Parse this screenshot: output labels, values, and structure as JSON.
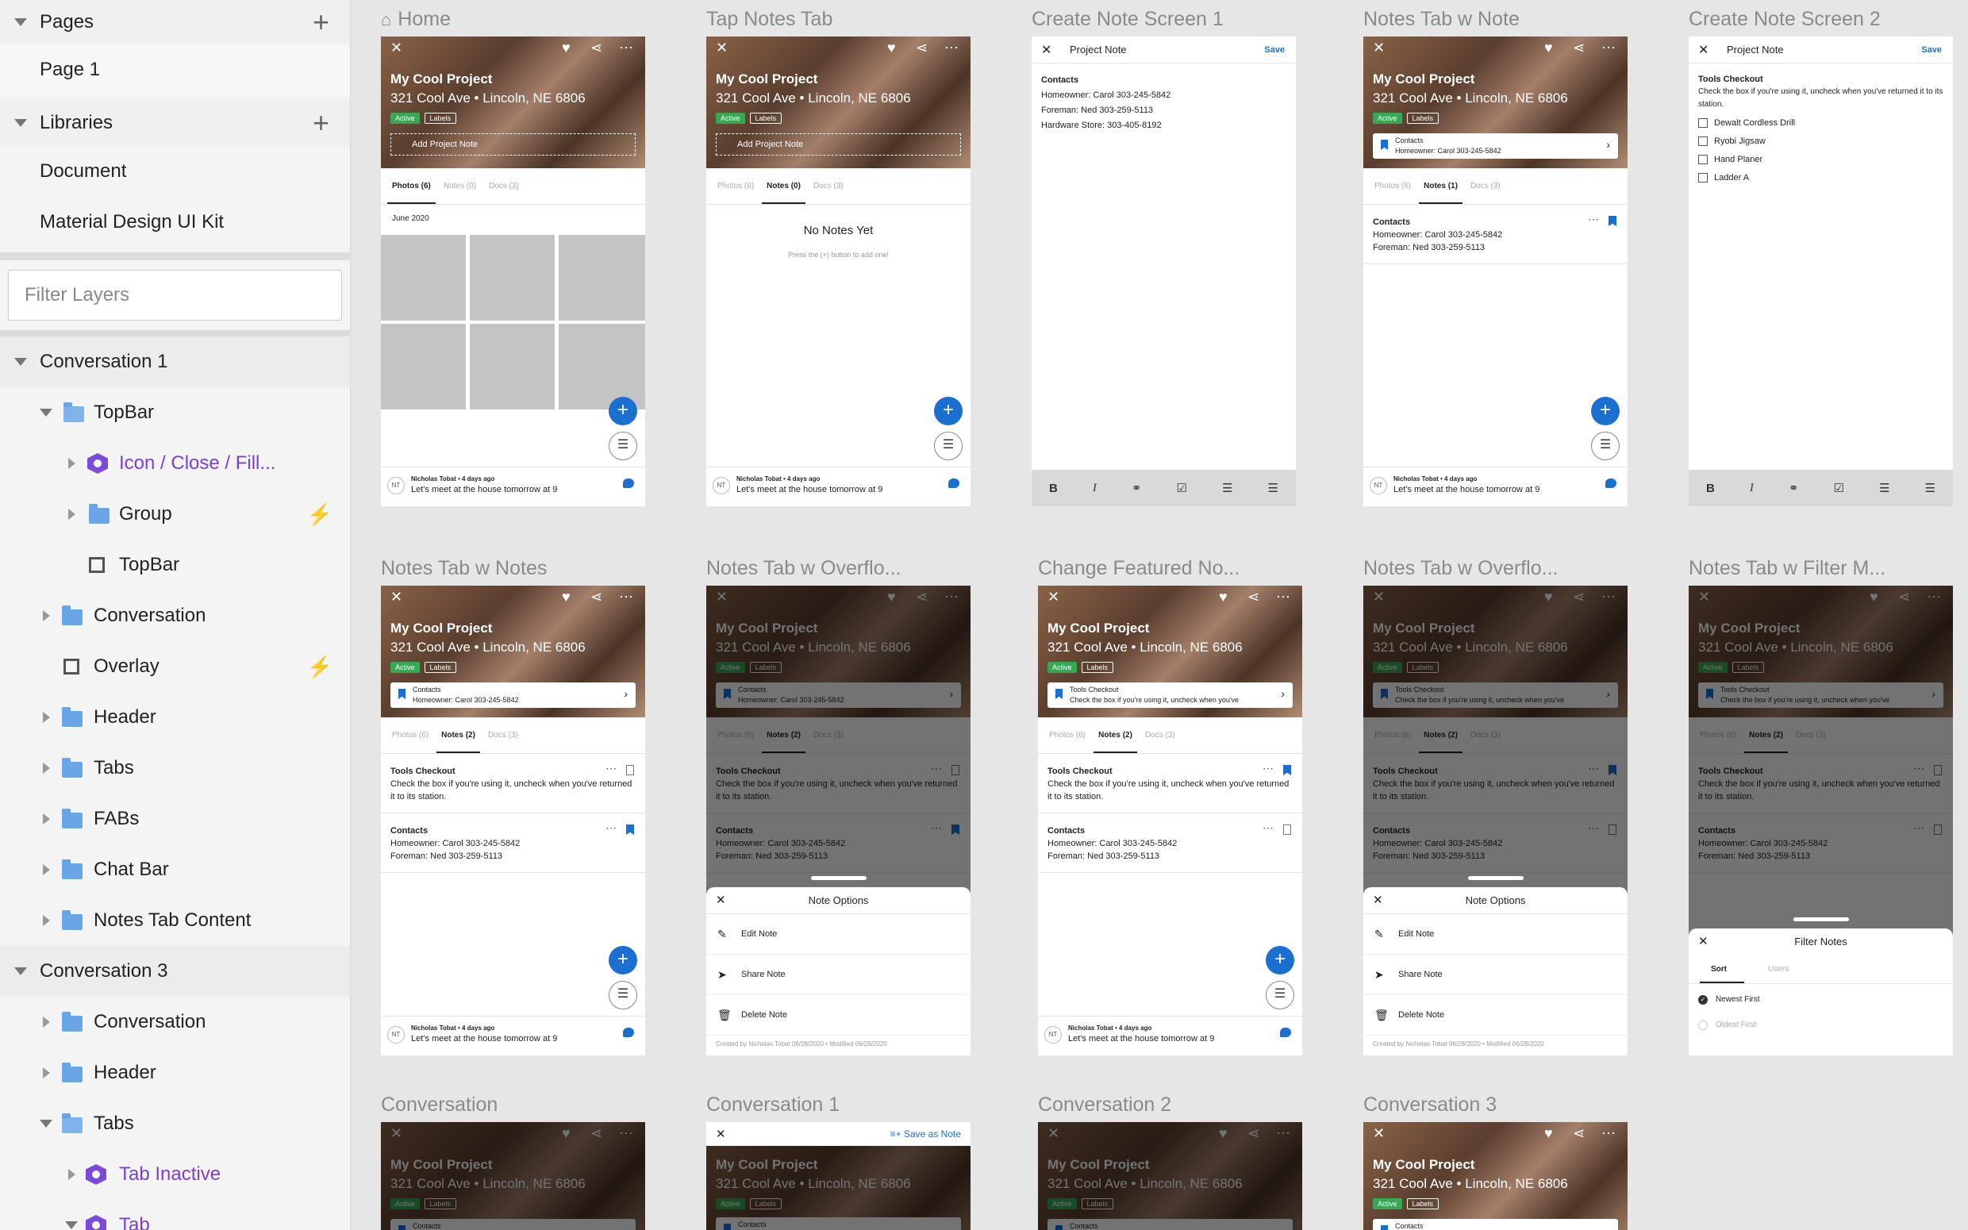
{
  "sidebar": {
    "pages_title": "Pages",
    "page1": "Page 1",
    "libraries_title": "Libraries",
    "lib_document": "Document",
    "lib_material": "Material Design UI Kit",
    "filter_placeholder": "Filter Layers",
    "layers": {
      "conversation1": "Conversation 1",
      "topbar_group": "TopBar",
      "icon_close": "Icon / Close / Fill...",
      "group": "Group",
      "topbar_layer": "TopBar",
      "conversation": "Conversation",
      "overlay": "Overlay",
      "header": "Header",
      "tabs": "Tabs",
      "fabs": "FABs",
      "chat_bar": "Chat Bar",
      "notes_tab_content": "Notes Tab Content",
      "conversation3": "Conversation 3",
      "c3_conversation": "Conversation",
      "c3_header": "Header",
      "c3_tabs": "Tabs",
      "tab_inactive": "Tab Inactive",
      "tab": "Tab"
    }
  },
  "frames": {
    "home": "Home",
    "tap_notes": "Tap Notes Tab",
    "create_note_1": "Create Note Screen 1",
    "notes_w_note": "Notes Tab w Note",
    "create_note_2": "Create Note Screen 2",
    "notes_w_notes": "Notes Tab w Notes",
    "notes_overflow_1": "Notes Tab w Overflo...",
    "change_featured": "Change Featured No...",
    "notes_overflow_2": "Notes Tab w Overflo...",
    "notes_filter": "Notes Tab w Filter M...",
    "conversation": "Conversation",
    "conversation_1": "Conversation 1",
    "conversation_2": "Conversation 2",
    "conversation_3": "Conversation 3"
  },
  "app": {
    "project_title": "My Cool Project",
    "project_address": "321 Cool Ave • Lincoln, NE 6806",
    "chip_active": "Active",
    "chip_labels": "Labels",
    "add_project_note": "Add Project Note",
    "tab_photos_6": "Photos (6)",
    "tab_notes_0": "Notes (0)",
    "tab_docs_3": "Docs (3)",
    "tab_notes_1": "Notes (1)",
    "tab_notes_2": "Notes (2)",
    "date_june": "June 2020",
    "no_notes_title": "No Notes Yet",
    "no_notes_sub": "Press the (+) button to add one!",
    "chat_name": "Nicholas Tobat • 4 days ago",
    "chat_msg": "Let's meet at the house tomorrow at 9",
    "chat_initials": "NT",
    "project_note": "Project Note",
    "save": "Save",
    "contacts": "Contacts",
    "homeowner": "Homeowner: Carol 303-245-5842",
    "foreman": "Foreman: Ned 303-259-5113",
    "hardware": "Hardware Store: 303-405-8192",
    "tools_checkout": "Tools Checkout",
    "tools_desc": "Check the box if you're using it, uncheck when you've returned it to its station.",
    "tools_desc_short": "Check the box if you're using it, uncheck when you've",
    "tool1": "Dewalt Cordless Drill",
    "tool2": "Ryobi Jigsaw",
    "tool3": "Hand Planer",
    "tool4": "Ladder A",
    "note_options": "Note Options",
    "edit_note": "Edit Note",
    "share_note": "Share Note",
    "delete_note": "Delete Note",
    "created_by": "Created by Nicholas Tobat 06/28/2020 • Modified 06/28/2020",
    "filter_notes": "Filter Notes",
    "sort": "Sort",
    "users": "Users",
    "newest_first": "Newest First",
    "oldest_first": "Oldest First",
    "save_as_note": "Save as Note"
  }
}
